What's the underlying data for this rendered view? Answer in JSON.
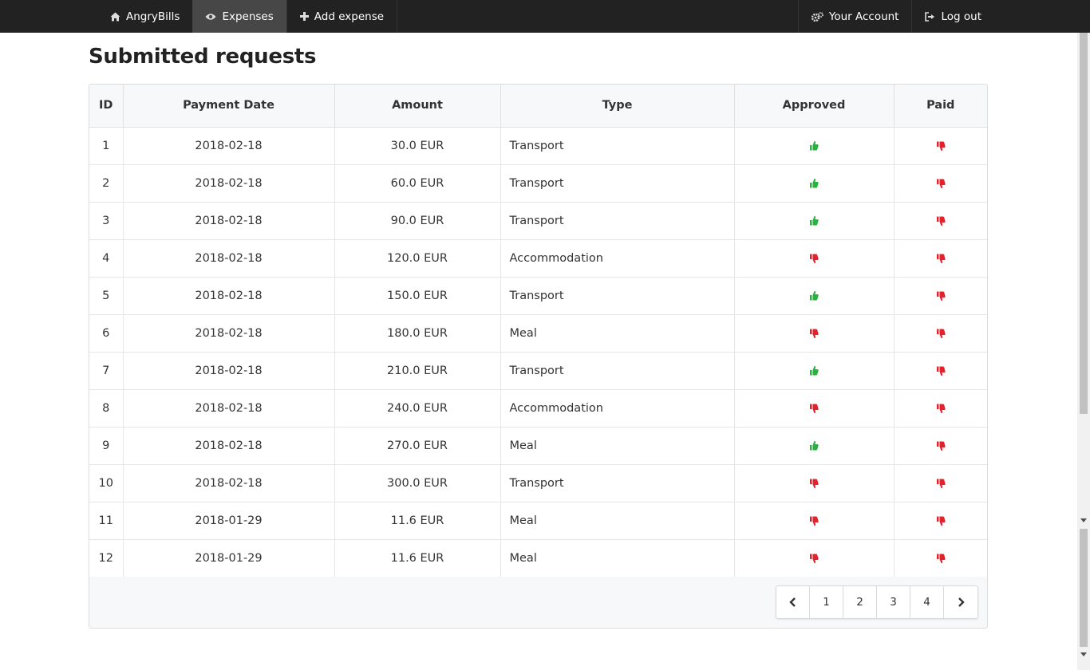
{
  "nav": {
    "brand": "AngryBills",
    "expenses": "Expenses",
    "add_expense": "Add expense",
    "your_account": "Your Account",
    "log_out": "Log out"
  },
  "page_title": "Submitted requests",
  "table": {
    "headers": [
      "ID",
      "Payment Date",
      "Amount",
      "Type",
      "Approved",
      "Paid"
    ],
    "rows": [
      {
        "id": "1",
        "date": "2018-02-18",
        "amount": "30.0 EUR",
        "type": "Transport",
        "approved": true,
        "paid": false
      },
      {
        "id": "2",
        "date": "2018-02-18",
        "amount": "60.0 EUR",
        "type": "Transport",
        "approved": true,
        "paid": false
      },
      {
        "id": "3",
        "date": "2018-02-18",
        "amount": "90.0 EUR",
        "type": "Transport",
        "approved": true,
        "paid": false
      },
      {
        "id": "4",
        "date": "2018-02-18",
        "amount": "120.0 EUR",
        "type": "Accommodation",
        "approved": false,
        "paid": false
      },
      {
        "id": "5",
        "date": "2018-02-18",
        "amount": "150.0 EUR",
        "type": "Transport",
        "approved": true,
        "paid": false
      },
      {
        "id": "6",
        "date": "2018-02-18",
        "amount": "180.0 EUR",
        "type": "Meal",
        "approved": false,
        "paid": false
      },
      {
        "id": "7",
        "date": "2018-02-18",
        "amount": "210.0 EUR",
        "type": "Transport",
        "approved": true,
        "paid": false
      },
      {
        "id": "8",
        "date": "2018-02-18",
        "amount": "240.0 EUR",
        "type": "Accommodation",
        "approved": false,
        "paid": false
      },
      {
        "id": "9",
        "date": "2018-02-18",
        "amount": "270.0 EUR",
        "type": "Meal",
        "approved": true,
        "paid": false
      },
      {
        "id": "10",
        "date": "2018-02-18",
        "amount": "300.0 EUR",
        "type": "Transport",
        "approved": false,
        "paid": false
      },
      {
        "id": "11",
        "date": "2018-01-29",
        "amount": "11.6 EUR",
        "type": "Meal",
        "approved": false,
        "paid": false
      },
      {
        "id": "12",
        "date": "2018-01-29",
        "amount": "11.6 EUR",
        "type": "Meal",
        "approved": false,
        "paid": false
      }
    ]
  },
  "pagination": {
    "pages": [
      "1",
      "2",
      "3",
      "4"
    ],
    "prev_icon": "chevron-left-icon",
    "next_icon": "chevron-right-icon"
  },
  "colors": {
    "navbar_bg": "#222222",
    "nav_active_bg": "#474747",
    "thumbs_up": "#27b43e",
    "thumbs_down": "#e0232c"
  },
  "icons": {
    "brand": "home-icon",
    "expenses": "eye-icon",
    "add_expense": "plus-icon",
    "your_account": "gears-icon",
    "log_out": "sign-out-icon",
    "approved_true": "thumbs-up-icon",
    "approved_false": "thumbs-down-icon"
  }
}
